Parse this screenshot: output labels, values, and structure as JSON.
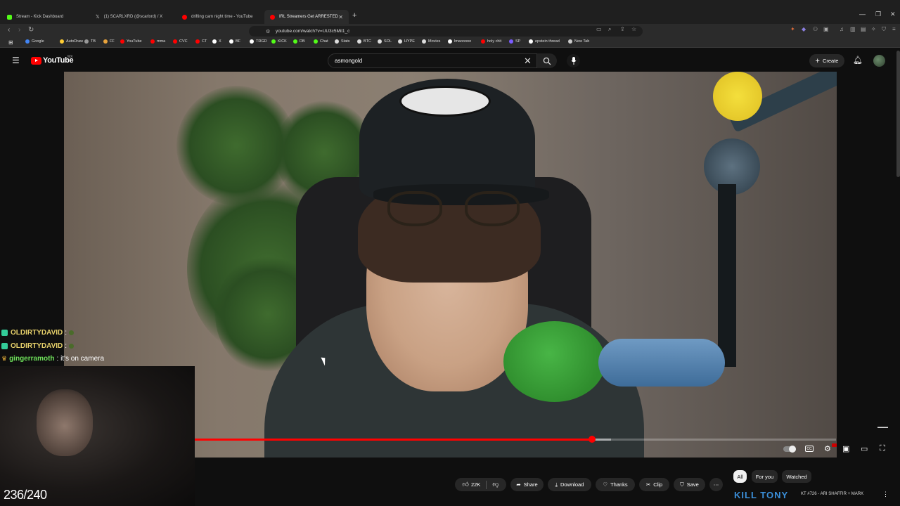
{
  "browser": {
    "tabs": [
      {
        "label": "Stream - Kick Dashboard",
        "color": "#53fc18"
      },
      {
        "label": "(1) SCARLXRD (@scarlxrd) / X",
        "color": "#ffffff"
      },
      {
        "label": "drifting cam night time - YouTube",
        "color": "#ff0000"
      },
      {
        "label": "IRL Streamers Get ARRESTED",
        "color": "#ff0000",
        "active": true
      }
    ],
    "url": "youtube.com/watch?v=UU3c5Mil1_c",
    "bookmarks": [
      {
        "label": "Google",
        "color": "#4285f4"
      },
      {
        "label": "AutoDraw",
        "color": "#ffcc33"
      },
      {
        "label": "TB",
        "color": "#999999"
      },
      {
        "label": "FF",
        "color": "#e8a33c"
      },
      {
        "label": "YouTube",
        "color": "#ff0000"
      },
      {
        "label": "mma",
        "color": "#ff0000"
      },
      {
        "label": "CVC",
        "color": "#ff0000"
      },
      {
        "label": "CT",
        "color": "#ff0000"
      },
      {
        "label": "X",
        "color": "#ffffff"
      },
      {
        "label": "BF",
        "color": "#ffffff"
      },
      {
        "label": "TRGD",
        "color": "#ffffff"
      },
      {
        "label": "KICK",
        "color": "#53fc18"
      },
      {
        "label": "DB",
        "color": "#53fc18"
      },
      {
        "label": "Chat",
        "color": "#53fc18"
      },
      {
        "label": "Stats",
        "color": "#dddddd"
      },
      {
        "label": "BTC",
        "color": "#dddddd"
      },
      {
        "label": "SOL",
        "color": "#dddddd"
      },
      {
        "label": "HYPE",
        "color": "#dddddd"
      },
      {
        "label": "Movies",
        "color": "#dddddd"
      },
      {
        "label": "lmaooooo",
        "color": "#ffffff"
      },
      {
        "label": "holy chit",
        "color": "#ff0000"
      },
      {
        "label": "SP",
        "color": "#7b5cff"
      },
      {
        "label": "epstein thread",
        "color": "#ffffff"
      },
      {
        "label": "New Tab",
        "color": "#cccccc"
      }
    ]
  },
  "youtube": {
    "logo_text": "YouTube",
    "region": "MX",
    "search_query": "asmongold",
    "create_label": "Create"
  },
  "video": {
    "progress": 0.62,
    "buffered": 0.65
  },
  "chat": [
    {
      "user": "OLDIRTYDAVID",
      "text": ":",
      "color": "#e8d26b"
    },
    {
      "user": "OLDIRTYDAVID",
      "text": ":",
      "color": "#e8d26b"
    },
    {
      "user": "gingerramoth",
      "text": ": it's on camera",
      "color": "#6ee05a"
    }
  ],
  "counter": "236/240",
  "actions": {
    "likes": "22K",
    "share": "Share",
    "download": "Download",
    "thanks": "Thanks",
    "clip": "Clip",
    "save": "Save"
  },
  "chips": [
    "All",
    "For you",
    "Watched"
  ],
  "ad": {
    "title": "KT #726 - ARI SHAFFIR + MARK"
  }
}
